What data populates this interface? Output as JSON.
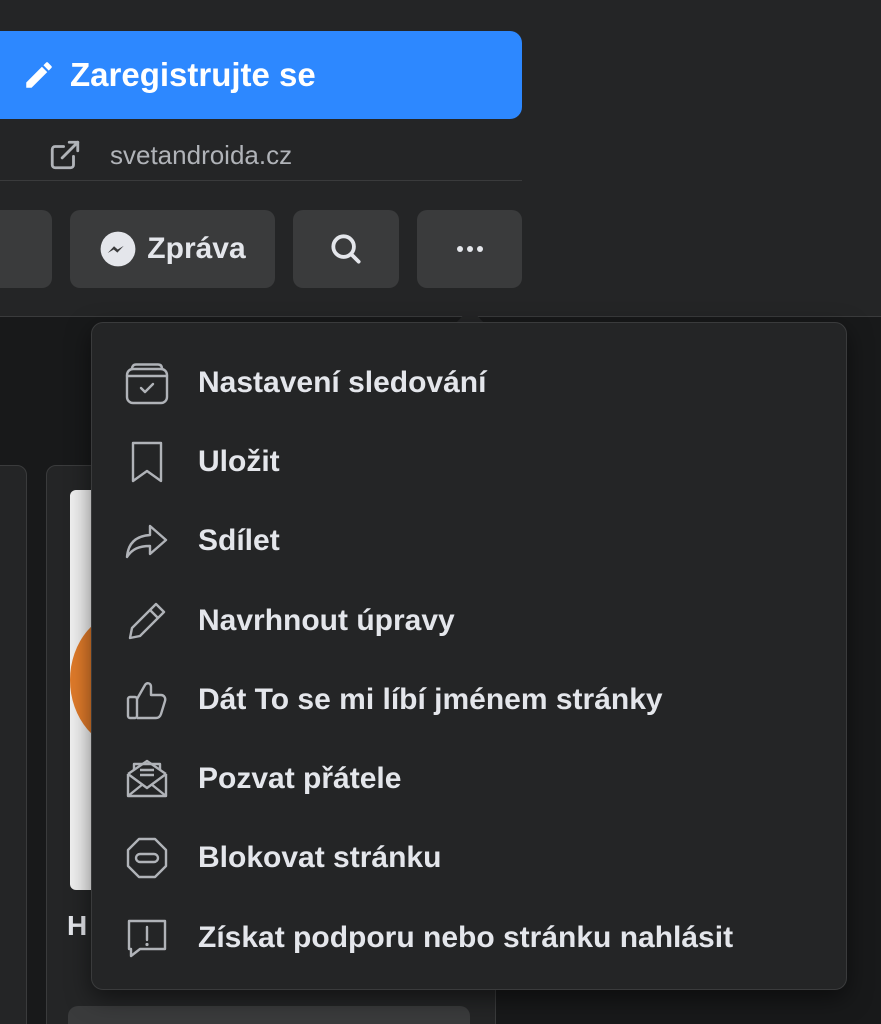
{
  "header": {
    "signup_label": "Zaregistrujte se",
    "website": "svetandroida.cz"
  },
  "actions": {
    "message_label": "Zpráva"
  },
  "menu": {
    "items": [
      {
        "label": "Nastavení sledování",
        "icon": "follow-settings-icon"
      },
      {
        "label": "Uložit",
        "icon": "bookmark-icon"
      },
      {
        "label": "Sdílet",
        "icon": "share-icon"
      },
      {
        "label": "Navrhnout úpravy",
        "icon": "pencil-icon"
      },
      {
        "label": "Dát To se mi líbí jménem stránky",
        "icon": "thumbs-up-icon"
      },
      {
        "label": "Pozvat přátele",
        "icon": "invite-envelope-icon"
      },
      {
        "label": "Blokovat stránku",
        "icon": "block-icon"
      },
      {
        "label": "Získat podporu nebo stránku nahlásit",
        "icon": "report-icon"
      }
    ]
  },
  "card": {
    "letter": "H"
  },
  "colors": {
    "accent": "#2d88ff",
    "background": "#18191a",
    "surface": "#242526",
    "button": "#3a3b3c",
    "text": "#e4e6eb",
    "secondary_text": "#b0b3b8"
  }
}
